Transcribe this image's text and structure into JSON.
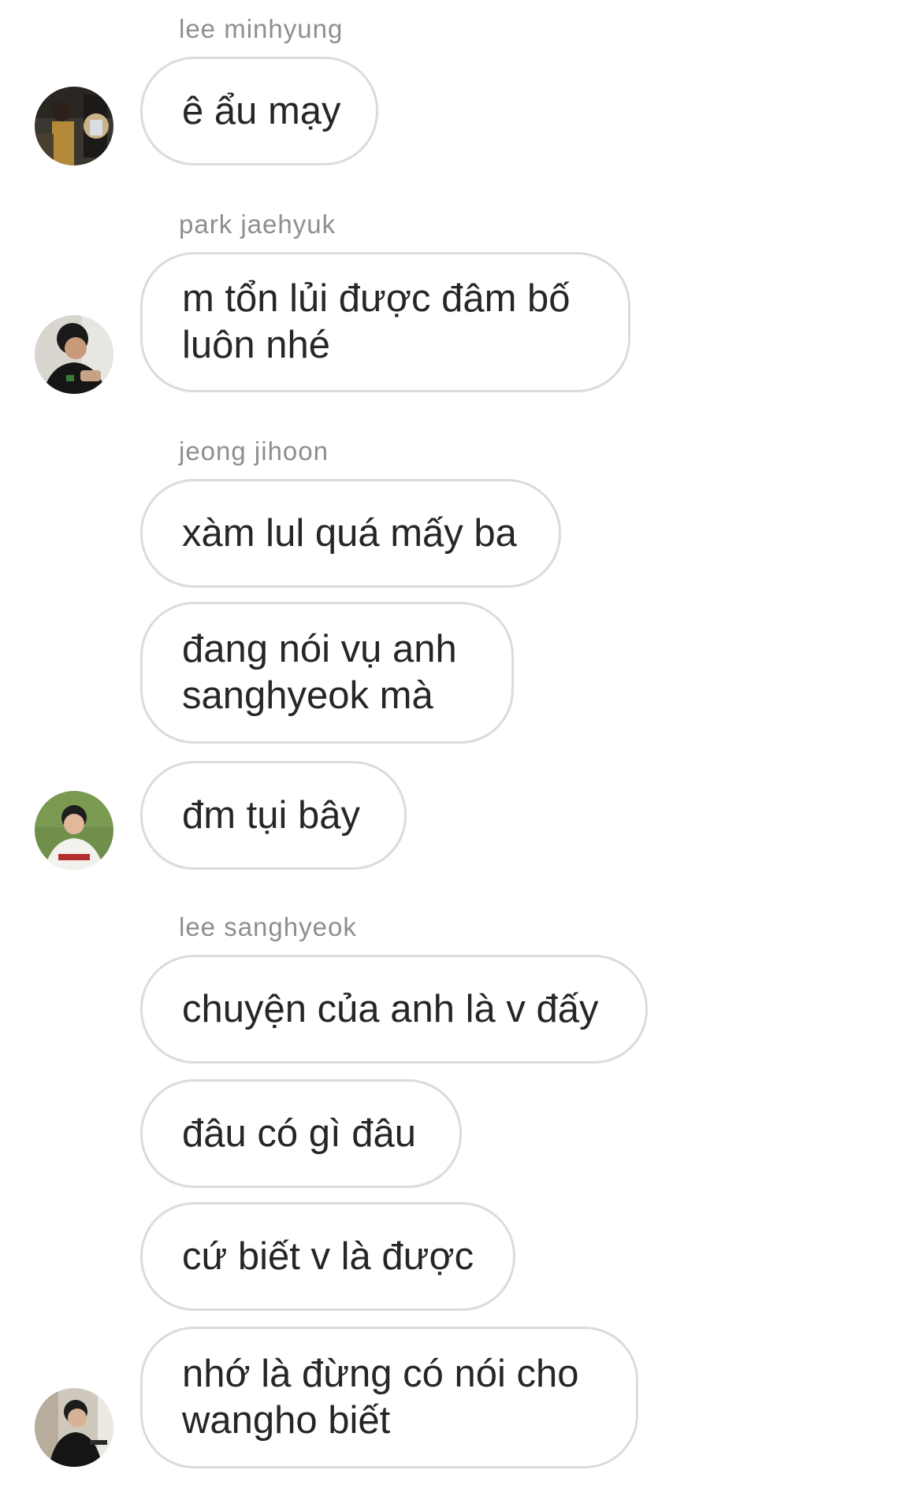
{
  "conversation": {
    "groups": [
      {
        "sender": "lee minhyung",
        "avatar_icon": "user-avatar-photo",
        "messages": [
          "ê ẩu mạy"
        ]
      },
      {
        "sender": "park jaehyuk",
        "avatar_icon": "user-avatar-photo",
        "messages": [
          "m tổn lủi được đâm bố\nluôn nhé"
        ]
      },
      {
        "sender": "jeong jihoon",
        "avatar_icon": "user-avatar-photo",
        "messages": [
          "xàm lul quá mấy ba",
          "đang nói vụ anh\nsanghyeok mà",
          "đm tụi bây"
        ]
      },
      {
        "sender": "lee sanghyeok",
        "avatar_icon": "user-avatar-photo",
        "messages": [
          "chuyện của anh là v đấy",
          "đâu có gì đâu",
          "cứ biết v là được",
          "nhớ là đừng có nói cho\nwangho biết"
        ]
      }
    ]
  },
  "colors": {
    "bubble_border": "#dbdbdb",
    "sender_text": "#8e8e8e",
    "message_text": "#262626",
    "background": "#ffffff"
  }
}
